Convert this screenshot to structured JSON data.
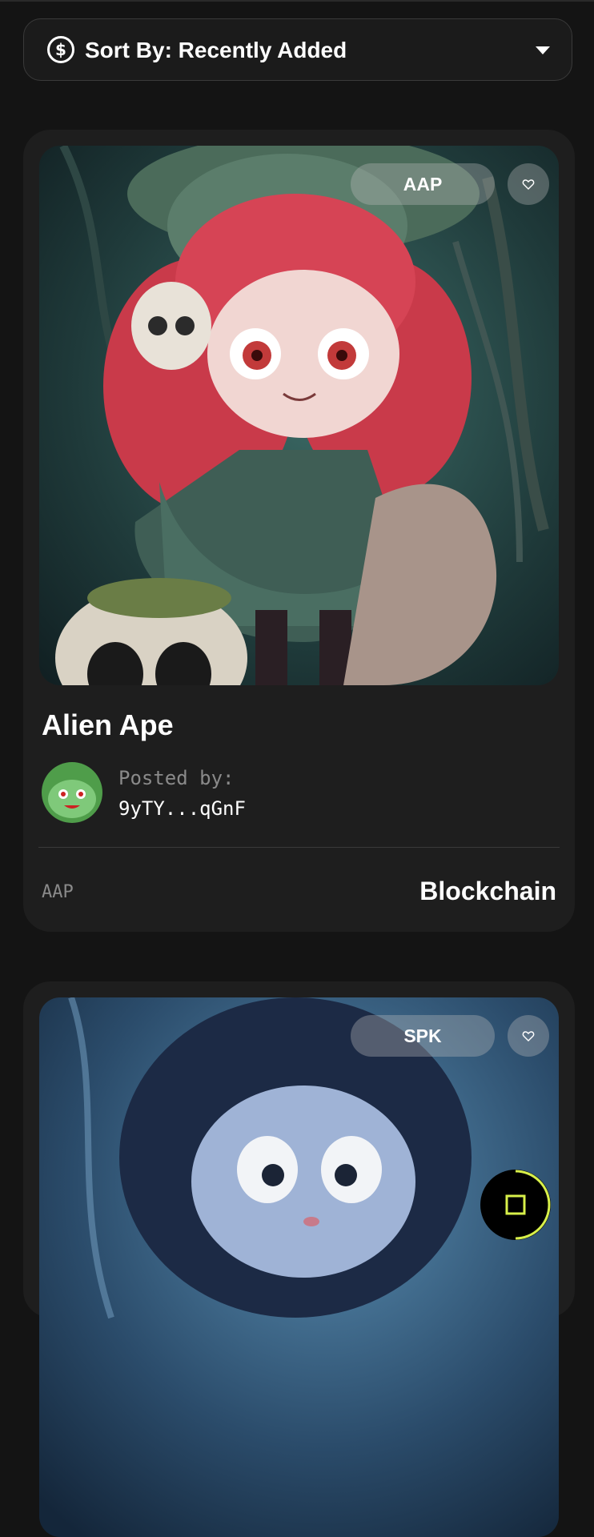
{
  "sort": {
    "label": "Sort By: Recently Added",
    "icon": "dollar-circle-icon"
  },
  "cards": [
    {
      "tag": "AAP",
      "title": "Alien Ape",
      "posted_label": "Posted by:",
      "address": "9yTY...qGnF",
      "symbol": "AAP",
      "chain": "Blockchain"
    },
    {
      "tag": "SPK"
    }
  ],
  "colors": {
    "background": "#141414",
    "card": "#1e1e1e",
    "accent": "#d8f04a"
  },
  "fab": {
    "icon": "stop-square-icon"
  }
}
